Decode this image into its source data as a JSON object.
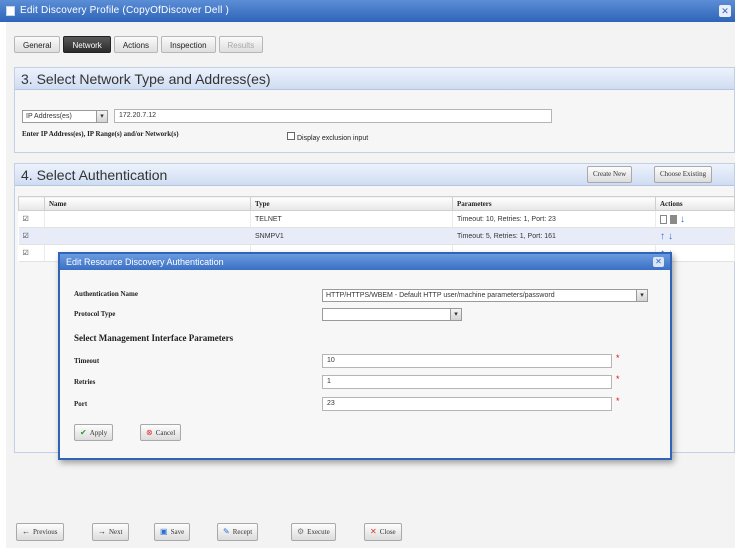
{
  "window": {
    "title": "Edit Discovery Profile (CopyOfDiscover Dell )"
  },
  "tabs": [
    {
      "label": "General"
    },
    {
      "label": "Network",
      "active": true
    },
    {
      "label": "Actions"
    },
    {
      "label": "Inspection"
    },
    {
      "label": "Results",
      "disabled": true
    }
  ],
  "network": {
    "heading": "3. Select Network Type and Address(es)",
    "type_selected": "IP Address(es)",
    "address_value": "172.20.7.12",
    "help_text": "Enter IP Address(es), IP Range(s) and/or Network(s)",
    "exclusion_label": "Display exclusion input"
  },
  "auth": {
    "heading": "4. Select Authentication",
    "create_new_label": "Create New",
    "choose_existing_label": "Choose Existing",
    "columns": [
      "Name",
      "Type",
      "Parameters",
      "Actions"
    ],
    "rows": [
      {
        "checked": "☑",
        "name": "",
        "type": "TELNET",
        "params": "Timeout: 10, Retries: 1, Port: 23"
      },
      {
        "checked": "☑",
        "name": "",
        "type": "SNMPV1",
        "params": "Timeout: 5, Retries: 1, Port: 161"
      },
      {
        "checked": "☑",
        "name": "",
        "type": "",
        "params": ""
      }
    ]
  },
  "dialog": {
    "title": "Edit Resource Discovery Authentication",
    "auth_name_label": "Authentication Name",
    "auth_name_value": "HTTP/HTTPS/WBEM - Default HTTP user/machine parameters/password",
    "protocol_label": "Protocol Type",
    "protocol_value": "",
    "params_heading": "Select Management Interface Parameters",
    "timeout_label": "Timeout",
    "timeout_value": "10",
    "retries_label": "Retries",
    "retries_value": "1",
    "port_label": "Port",
    "port_value": "23",
    "apply_label": "Apply",
    "cancel_label": "Cancel"
  },
  "footer": {
    "previous_label": "Previous",
    "next_label": "Next",
    "save_label": "Save",
    "recept_label": "Recept",
    "execute_label": "Execute",
    "close_label": "Close"
  },
  "colors": {
    "accent": "#2f64b8",
    "required": "#dd1111",
    "arrow_icon": "#2a6fd1"
  }
}
